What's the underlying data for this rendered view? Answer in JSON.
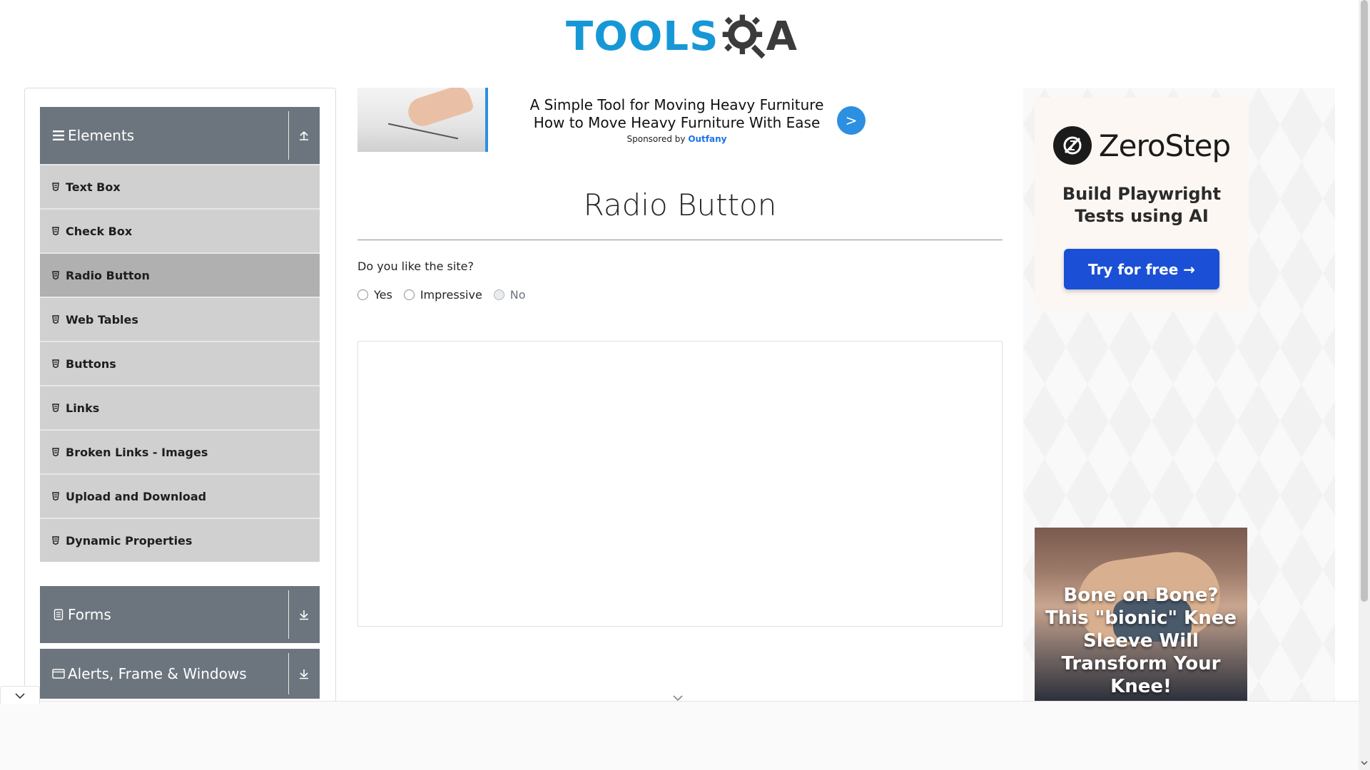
{
  "header": {
    "logo_text_tools": "TOOLS",
    "logo_text_a": "A"
  },
  "sidebar": {
    "groups": [
      {
        "label": "Elements",
        "icon": "hamburger-icon",
        "state": "expanded"
      },
      {
        "label": "Forms",
        "icon": "document-icon",
        "state": "collapsed"
      },
      {
        "label": "Alerts, Frame & Windows",
        "icon": "window-icon",
        "state": "collapsed"
      }
    ],
    "items": [
      {
        "label": "Text Box"
      },
      {
        "label": "Check Box"
      },
      {
        "label": "Radio Button",
        "active": true
      },
      {
        "label": "Web Tables"
      },
      {
        "label": "Buttons"
      },
      {
        "label": "Links"
      },
      {
        "label": "Broken Links - Images"
      },
      {
        "label": "Upload and Download"
      },
      {
        "label": "Dynamic Properties"
      }
    ]
  },
  "ad_banner": {
    "headline": "A Simple Tool for Moving Heavy Furniture How to Move Heavy Furniture With Ease",
    "sponsor_prefix": "Sponsored by",
    "sponsor_brand": "Outfany",
    "go_label": ">"
  },
  "main": {
    "title": "Radio Button",
    "question": "Do you like the site?",
    "options": [
      {
        "label": "Yes",
        "disabled": false
      },
      {
        "label": "Impressive",
        "disabled": false
      },
      {
        "label": "No",
        "disabled": true
      }
    ]
  },
  "right_ad": {
    "brand": "ZeroStep",
    "tagline": "Build Playwright Tests using AI",
    "cta": "Try for free →",
    "knee_headline": "Bone on Bone? This \"bionic\" Knee Sleeve Will Transform Your Knee!"
  },
  "colors": {
    "brand_blue": "#1798d6",
    "sidebar_header": "#6c757d",
    "menu_item": "#d0d0d0",
    "menu_item_active": "#b0b0b0",
    "cta_blue": "#1a4fd6"
  }
}
